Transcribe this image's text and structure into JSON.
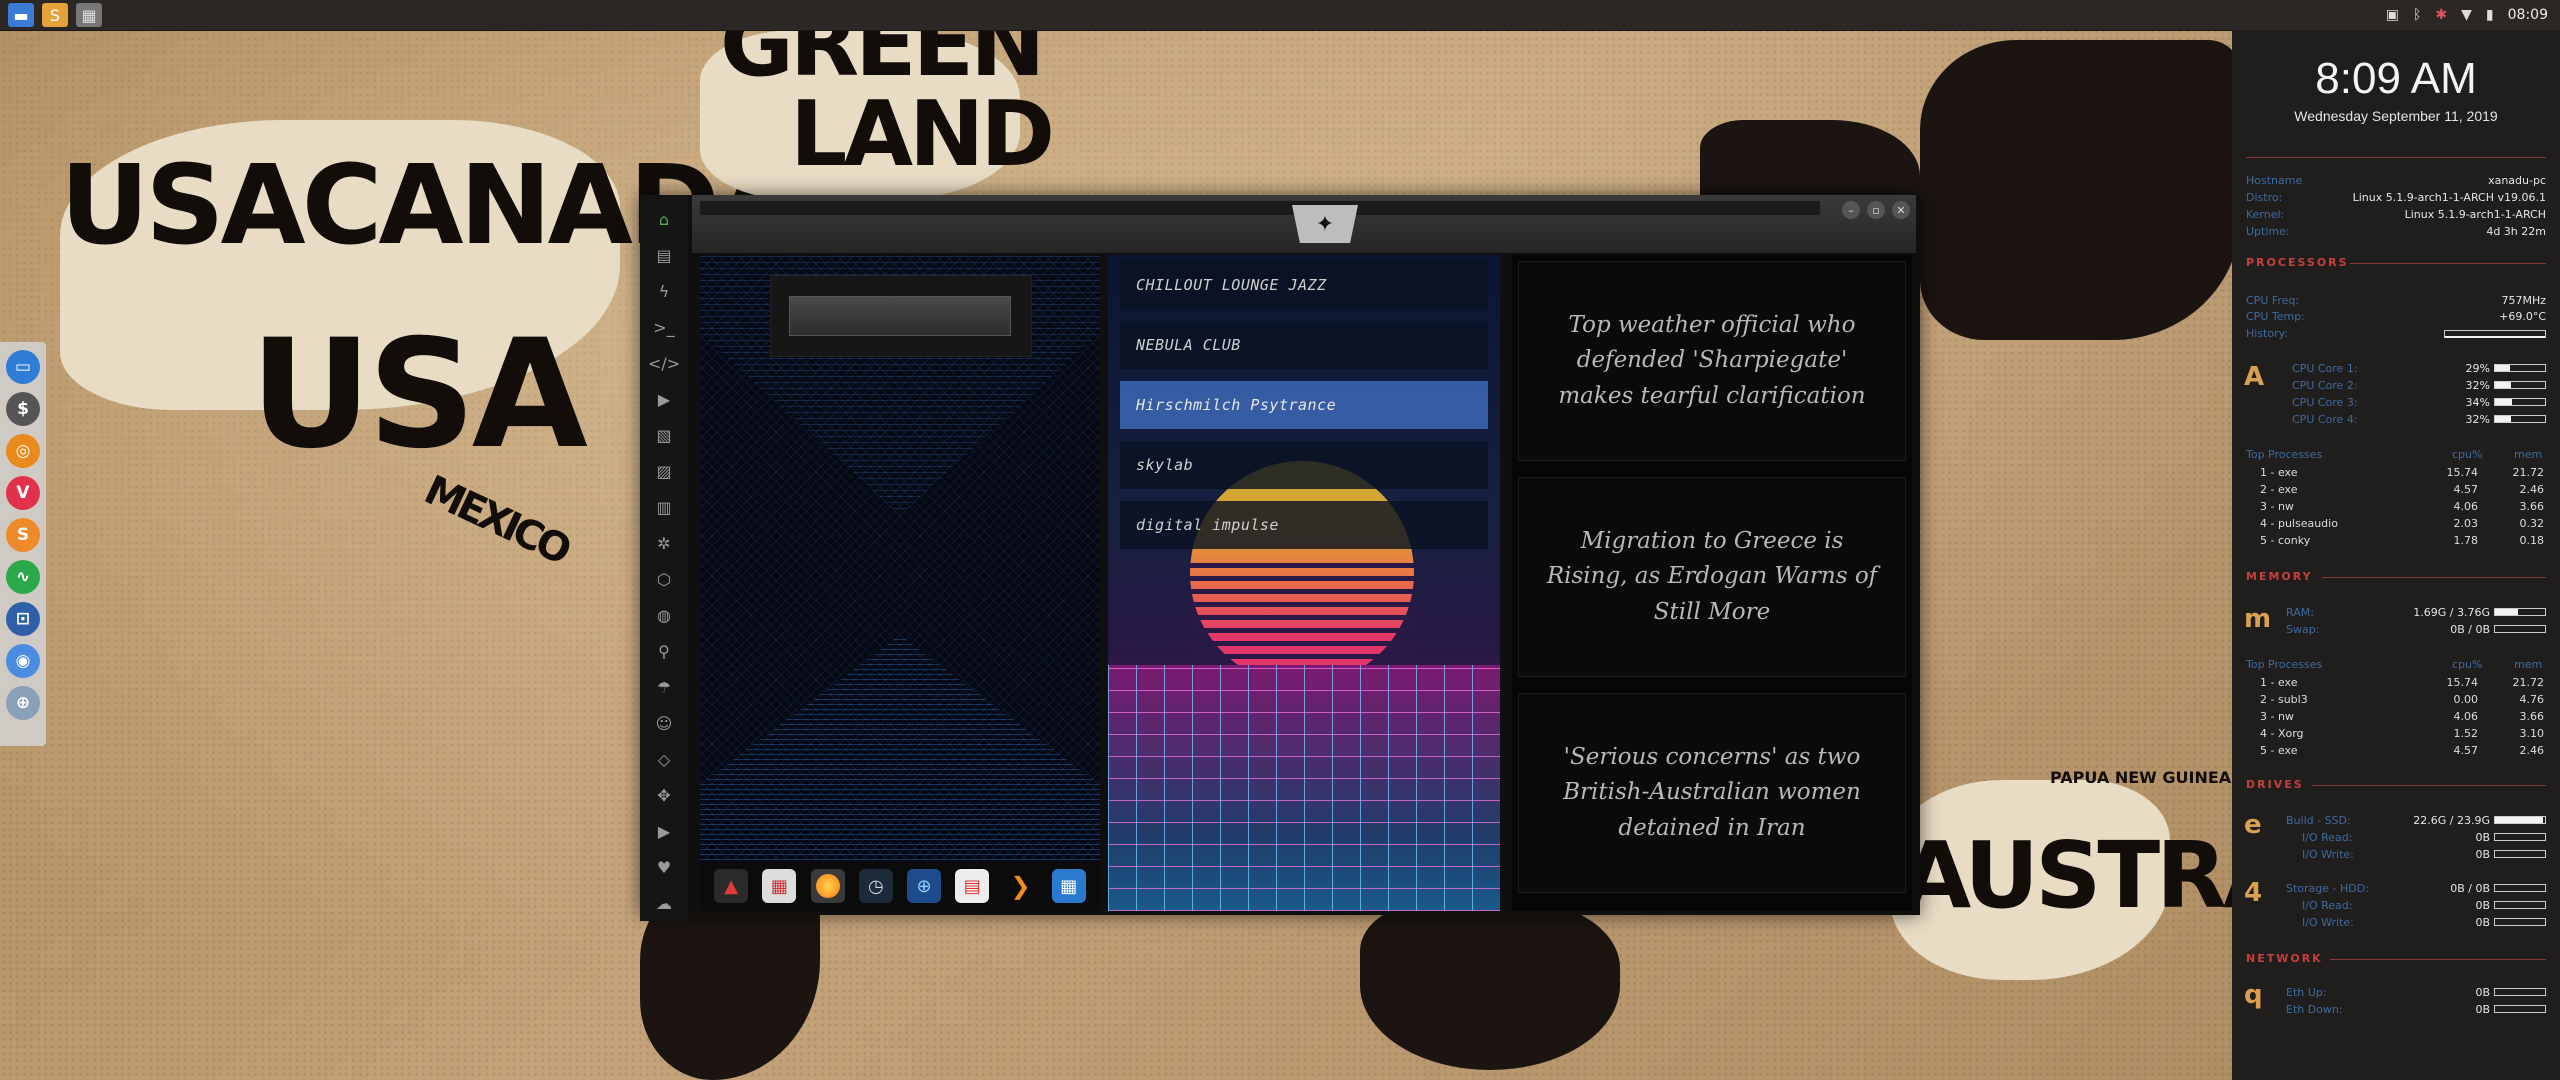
{
  "desktop": {
    "map_labels": [
      "GREEN",
      "LAND",
      "USA",
      "CANADA",
      "USA",
      "MEXICO",
      "AUSTRALIA",
      "PAPUA NEW GUINEA"
    ]
  },
  "topbar": {
    "time": "08:09",
    "tray_icons": [
      "image-icon",
      "bluetooth-icon",
      "debian-icon",
      "wifi-icon",
      "battery-icon"
    ]
  },
  "dock": {
    "items": [
      "files-icon",
      "terminal-icon",
      "ubuntu-icon",
      "vivaldi-icon",
      "sublime-icon",
      "monitor-icon",
      "screenshot-icon",
      "chromium-icon",
      "world-icon"
    ]
  },
  "window": {
    "search_placeholder": "",
    "stations": [
      {
        "label": "CHILLOUT LOUNGE JAZZ",
        "selected": false
      },
      {
        "label": "NEBULA CLUB",
        "selected": false
      },
      {
        "label": "Hirschmilch Psytrance",
        "selected": true
      },
      {
        "label": "skylab",
        "selected": false
      },
      {
        "label": "digital impulse",
        "selected": false
      }
    ],
    "news": [
      "Top weather official who defended 'Sharpiegate' makes tearful clarification",
      "Migration to Greece is Rising, as Erdogan Warns of Still More",
      "'Serious concerns' as two British-Australian women detained in Iran"
    ],
    "app_dock": [
      "adobe-icon",
      "calendar-icon",
      "firefox-icon",
      "clock-icon",
      "globe-icon",
      "agenda-icon",
      "arrow-icon",
      "calculator-icon"
    ]
  },
  "conky": {
    "time": "8:09 AM",
    "date": "Wednesday September 11, 2019",
    "system": {
      "hostname_label": "Hostname",
      "hostname": "xanadu-pc",
      "distro_label": "Distro:",
      "distro": "Linux 5.1.9-arch1-1-ARCH v19.06.1",
      "kernel_label": "Kernel:",
      "kernel": "Linux 5.1.9-arch1-1-ARCH",
      "uptime_label": "Uptime:",
      "uptime": "4d 3h 22m"
    },
    "processors": {
      "title": "PROCESSORS",
      "freq_label": "CPU Freq:",
      "freq": "757MHz",
      "temp_label": "CPU Temp:",
      "temp": "+69.0°C",
      "history_label": "History:",
      "letter": "A",
      "cores": [
        {
          "label": "CPU Core 1:",
          "value": "29%",
          "pct": 29
        },
        {
          "label": "CPU Core 2:",
          "value": "32%",
          "pct": 32
        },
        {
          "label": "CPU Core 3:",
          "value": "34%",
          "pct": 34
        },
        {
          "label": "CPU Core 4:",
          "value": "32%",
          "pct": 32
        }
      ],
      "top_title": "Top Processes",
      "col_cpu": "cpu%",
      "col_mem": "mem",
      "top": [
        {
          "n": "1 - exe",
          "cpu": "15.74",
          "mem": "21.72"
        },
        {
          "n": "2 - exe",
          "cpu": "4.57",
          "mem": "2.46"
        },
        {
          "n": "3 - nw",
          "cpu": "4.06",
          "mem": "3.66"
        },
        {
          "n": "4 - pulseaudio",
          "cpu": "2.03",
          "mem": "0.32"
        },
        {
          "n": "5 - conky",
          "cpu": "1.78",
          "mem": "0.18"
        }
      ]
    },
    "memory": {
      "title": "MEMORY",
      "letter": "m",
      "ram_label": "RAM:",
      "ram": "1.69G / 3.76G",
      "ram_pct": 45,
      "swap_label": "Swap:",
      "swap": "0B / 0B",
      "swap_pct": 0,
      "top_title": "Top Processes",
      "col_cpu": "cpu%",
      "col_mem": "mem",
      "top": [
        {
          "n": "1 - exe",
          "cpu": "15.74",
          "mem": "21.72"
        },
        {
          "n": "2 - subl3",
          "cpu": "0.00",
          "mem": "4.76"
        },
        {
          "n": "3 - nw",
          "cpu": "4.06",
          "mem": "3.66"
        },
        {
          "n": "4 - Xorg",
          "cpu": "1.52",
          "mem": "3.10"
        },
        {
          "n": "5 - exe",
          "cpu": "4.57",
          "mem": "2.46"
        }
      ]
    },
    "drives": {
      "title": "DRIVES",
      "letter1": "e",
      "build_label": "Build - SSD:",
      "build": "22.6G / 23.9G",
      "build_pct": 95,
      "io_read_label": "I/O Read:",
      "io_read": "0B",
      "io_write_label": "I/O Write:",
      "io_write": "0B",
      "letter2": "4",
      "storage_label": "Storage - HDD:",
      "storage": "0B / 0B",
      "storage_pct": 0,
      "io2_read_label": "I/O Read:",
      "io2_read": "0B",
      "io2_write_label": "I/O Write:",
      "io2_write": "0B"
    },
    "network": {
      "title": "NETWORK",
      "letter": "q",
      "up_label": "Eth Up:",
      "up": "0B",
      "down_label": "Eth Down:",
      "down": "0B"
    }
  }
}
